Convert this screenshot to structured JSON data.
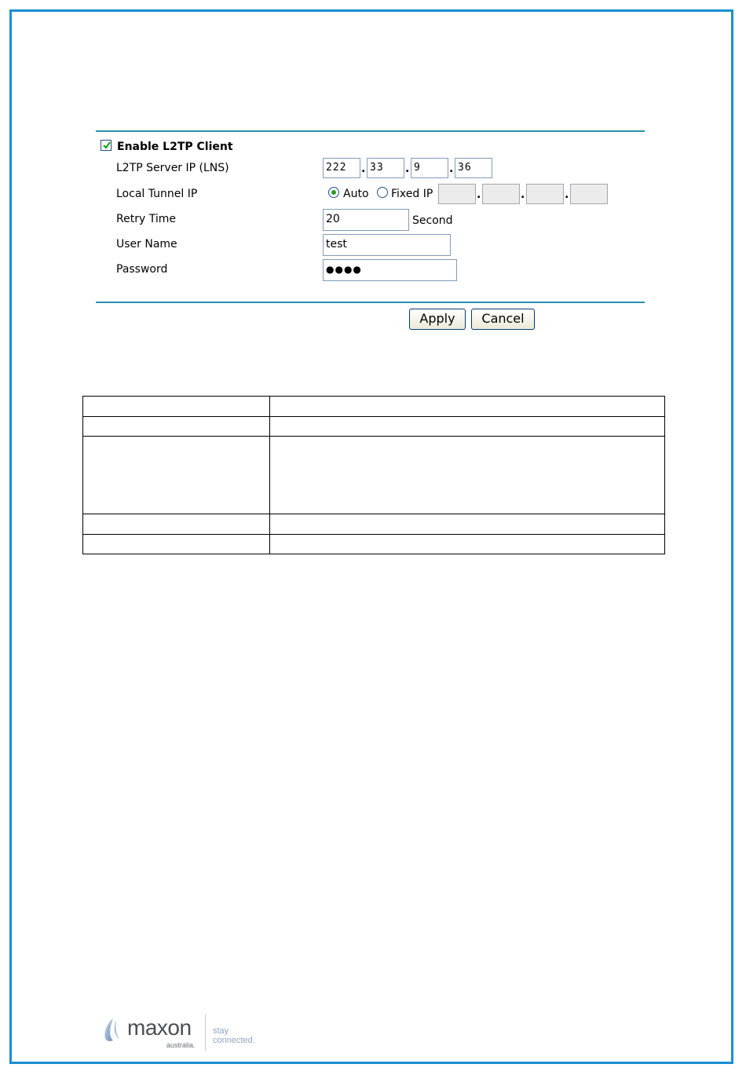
{
  "l2tp_form": {
    "enable_label": "Enable L2TP Client",
    "enable_checked": true,
    "server_ip_label": "L2TP Server IP (LNS)",
    "server_ip": [
      "222",
      "33",
      "9",
      "36"
    ],
    "local_tunnel_label": "Local Tunnel IP",
    "auto_label": "Auto",
    "fixed_ip_label": "Fixed IP",
    "tunnel_mode_selected": "Auto",
    "fixed_ip": [
      "",
      "",
      "",
      ""
    ],
    "retry_label": "Retry Time",
    "retry_value": "20",
    "retry_unit": "Second",
    "username_label": "User Name",
    "username_value": "test",
    "password_label": "Password",
    "password_masked": "●●●●"
  },
  "buttons": {
    "apply": "Apply",
    "cancel": "Cancel"
  },
  "table": {
    "rows": 5,
    "cols": 2
  },
  "footer": {
    "brand": "maxon",
    "brand_sub": "australia.",
    "tagline": "stay connected."
  },
  "colors": {
    "border": "#1a8fd0",
    "separator": "#2c8fb0",
    "check": "#21a121"
  }
}
